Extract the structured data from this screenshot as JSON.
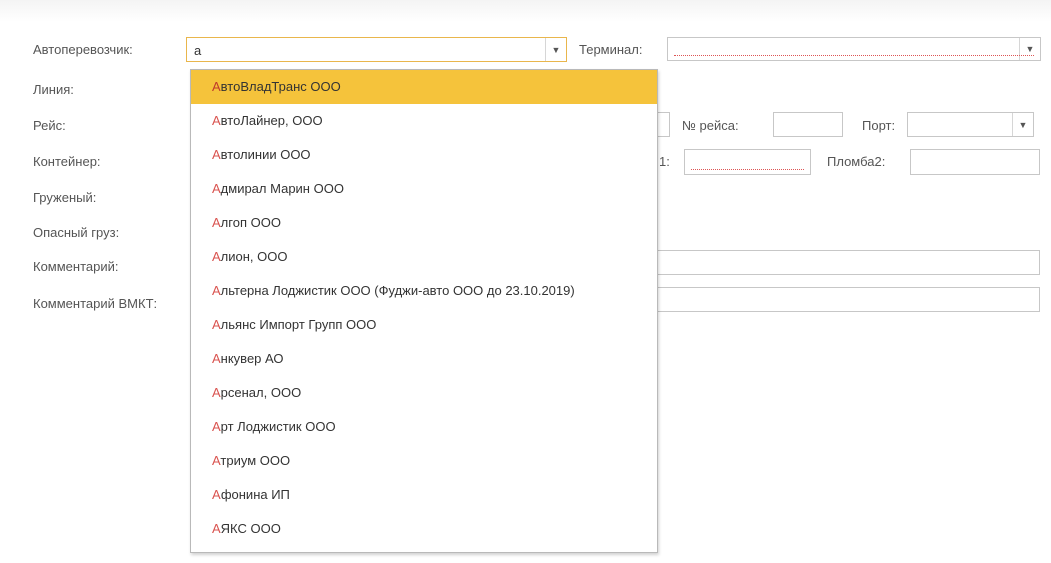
{
  "form": {
    "carrier_label": "Автоперевозчик:",
    "carrier_value": "а",
    "terminal_label": "Терминал:",
    "line_label": "Линия:",
    "voyage_label": "Рейс:",
    "voyage_no_label": "№ рейса:",
    "port_label": "Порт:",
    "container_label": "Контейнер:",
    "seal1_label": "1:",
    "seal2_label": "Пломба2:",
    "loaded_label": "Груженый:",
    "dangerous_label": "Опасный груз:",
    "comment_label": "Комментарий:",
    "comment_vmkt_label": "Комментарий ВМКТ:"
  },
  "dropdown": {
    "items": [
      {
        "first": "А",
        "rest": "втоВладТранс ООО",
        "highlighted": true
      },
      {
        "first": "А",
        "rest": "втоЛайнер, ООО"
      },
      {
        "first": "А",
        "rest": "втолинии ООО"
      },
      {
        "first": "А",
        "rest": "дмирал Марин ООО"
      },
      {
        "first": "А",
        "rest": "лгоп ООО"
      },
      {
        "first": "А",
        "rest": "лион, ООО"
      },
      {
        "first": "А",
        "rest": "льтерна Лоджистик ООО (Фуджи-авто ООО до 23.10.2019)"
      },
      {
        "first": "А",
        "rest": "льянс Импорт Групп ООО"
      },
      {
        "first": "А",
        "rest": "нкувер АО"
      },
      {
        "first": "А",
        "rest": "рсенал, ООО"
      },
      {
        "first": "А",
        "rest": "рт Лоджистик ООО"
      },
      {
        "first": "А",
        "rest": "триум ООО"
      },
      {
        "first": "А",
        "rest": "фонина ИП"
      },
      {
        "first": "А",
        "rest": "ЯКС ООО"
      }
    ]
  },
  "colors": {
    "highlight": "#f5c33b",
    "match_letter": "#d9534f",
    "active_border": "#e9b64c"
  }
}
